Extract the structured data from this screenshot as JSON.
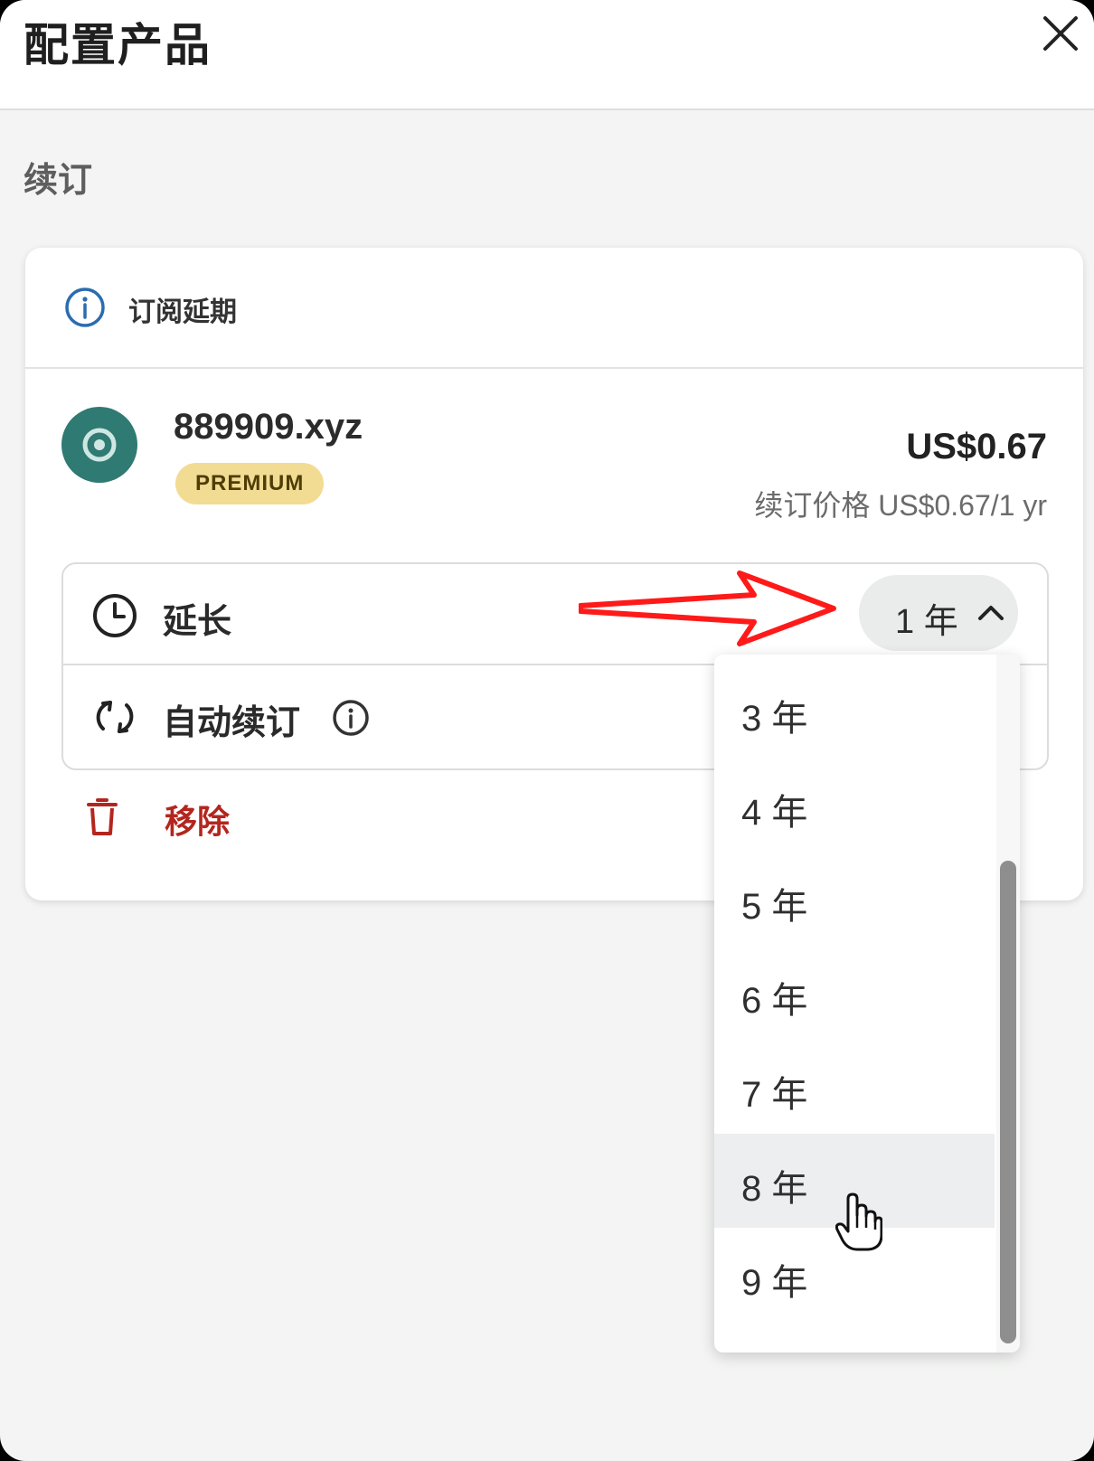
{
  "header": {
    "title": "配置产品",
    "close_icon": "close-icon"
  },
  "section": {
    "label": "续订"
  },
  "card": {
    "notice": {
      "text": "订阅延期",
      "icon": "info-icon"
    },
    "product": {
      "domain": "889909.xyz",
      "badge": "PREMIUM",
      "price": "US$0.67",
      "renew_price": "续订价格 US$0.67/1 yr",
      "avatar_icon": "spiral-icon"
    },
    "extend": {
      "label": "延长",
      "icon": "clock-icon",
      "selected": "1 年",
      "chevron": "chevron-up-icon"
    },
    "auto_renew": {
      "label": "自动续订",
      "icon": "sync-icon",
      "info_icon": "info-icon"
    },
    "remove": {
      "label": "移除",
      "icon": "trash-icon"
    }
  },
  "dropdown": {
    "options": [
      "3 年",
      "4 年",
      "5 年",
      "6 年",
      "7 年",
      "8 年",
      "9 年"
    ],
    "hovered": "8 年"
  },
  "colors": {
    "avatar": "#2f7a72",
    "badge": "#f2dc93",
    "remove": "#b3261e",
    "annotation_arrow": "#ff1a1a"
  }
}
